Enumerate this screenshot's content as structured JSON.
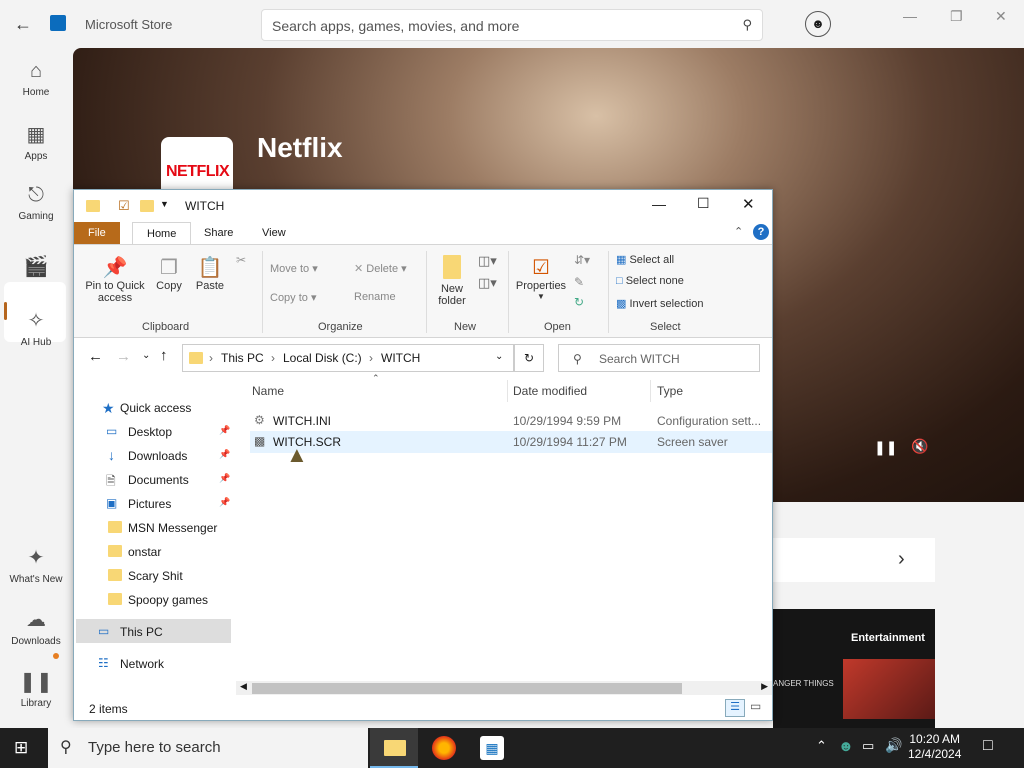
{
  "store": {
    "title": "Microsoft Store",
    "search_placeholder": "Search apps, games, movies, and more",
    "nav": [
      {
        "label": "Home"
      },
      {
        "label": "Apps"
      },
      {
        "label": "Gaming"
      },
      {
        "label": ""
      },
      {
        "label": "AI Hub"
      },
      {
        "label": "What's New"
      },
      {
        "label": "Downloads"
      },
      {
        "label": "Library"
      }
    ],
    "hero_app": "Netflix",
    "hero_logo_text": "NETFLIX",
    "card_title": "Entertainment",
    "card_sub": "ANGER THINGS"
  },
  "explorer": {
    "title": "WITCH",
    "tabs": [
      "File",
      "Home",
      "Share",
      "View"
    ],
    "ribbon": {
      "pin": "Pin to Quick access",
      "copy": "Copy",
      "paste": "Paste",
      "move_to": "Move to",
      "copy_to": "Copy to",
      "delete": "Delete",
      "rename": "Rename",
      "new_folder": "New folder",
      "properties": "Properties",
      "select_all": "Select all",
      "select_none": "Select none",
      "invert_selection": "Invert selection",
      "groups": [
        "Clipboard",
        "Organize",
        "New",
        "Open",
        "Select"
      ]
    },
    "breadcrumb": [
      "This PC",
      "Local Disk (C:)",
      "WITCH"
    ],
    "search_placeholder": "Search WITCH",
    "nav_pane": {
      "quick_access": "Quick access",
      "pinned": [
        "Desktop",
        "Downloads",
        "Documents",
        "Pictures"
      ],
      "folders": [
        "MSN Messenger",
        "onstar",
        "Scary Shit",
        "Spoopy games"
      ],
      "this_pc": "This PC",
      "network": "Network"
    },
    "columns": [
      "Name",
      "Date modified",
      "Type"
    ],
    "files": [
      {
        "name": "WITCH.INI",
        "date": "10/29/1994 9:59 PM",
        "type": "Configuration sett..."
      },
      {
        "name": "WITCH.SCR",
        "date": "10/29/1994 11:27 PM",
        "type": "Screen saver"
      }
    ],
    "status": "2 items"
  },
  "taskbar": {
    "search_placeholder": "Type here to search",
    "time": "10:20 AM",
    "date": "12/4/2024"
  }
}
